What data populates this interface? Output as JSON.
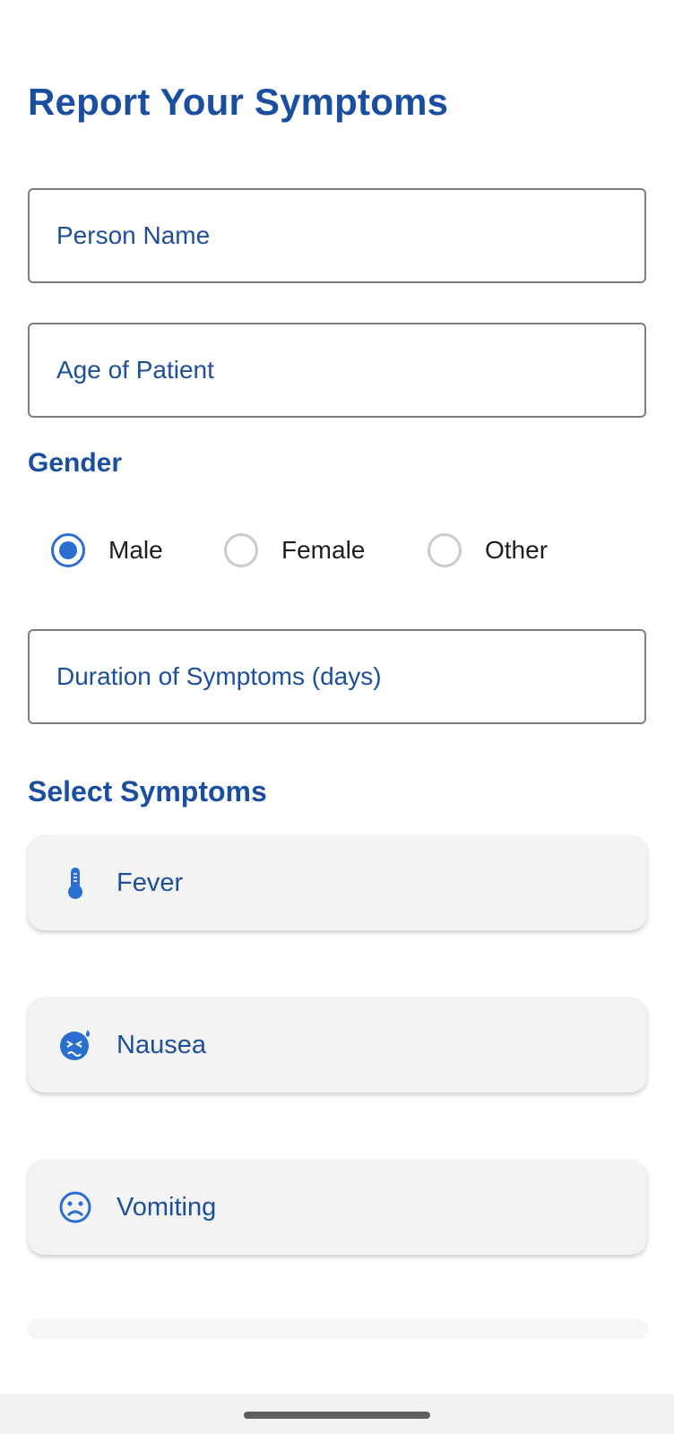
{
  "header": {
    "title": "Report Your Symptoms"
  },
  "form": {
    "name_placeholder": "Person Name",
    "age_placeholder": "Age of Patient",
    "gender_label": "Gender",
    "gender_options": [
      {
        "label": "Male",
        "selected": true
      },
      {
        "label": "Female",
        "selected": false
      },
      {
        "label": "Other",
        "selected": false
      }
    ],
    "duration_placeholder": "Duration of Symptoms (days)"
  },
  "symptoms": {
    "section_label": "Select Symptoms",
    "items": [
      {
        "label": "Fever",
        "icon": "thermometer-icon"
      },
      {
        "label": "Nausea",
        "icon": "nausea-face-icon"
      },
      {
        "label": "Vomiting",
        "icon": "sad-face-icon"
      }
    ]
  },
  "theme": {
    "primary": "#1a4fa0",
    "accent": "#2a6fd0",
    "card_bg": "#f3f3f3",
    "field_border": "#7d7d7d"
  }
}
